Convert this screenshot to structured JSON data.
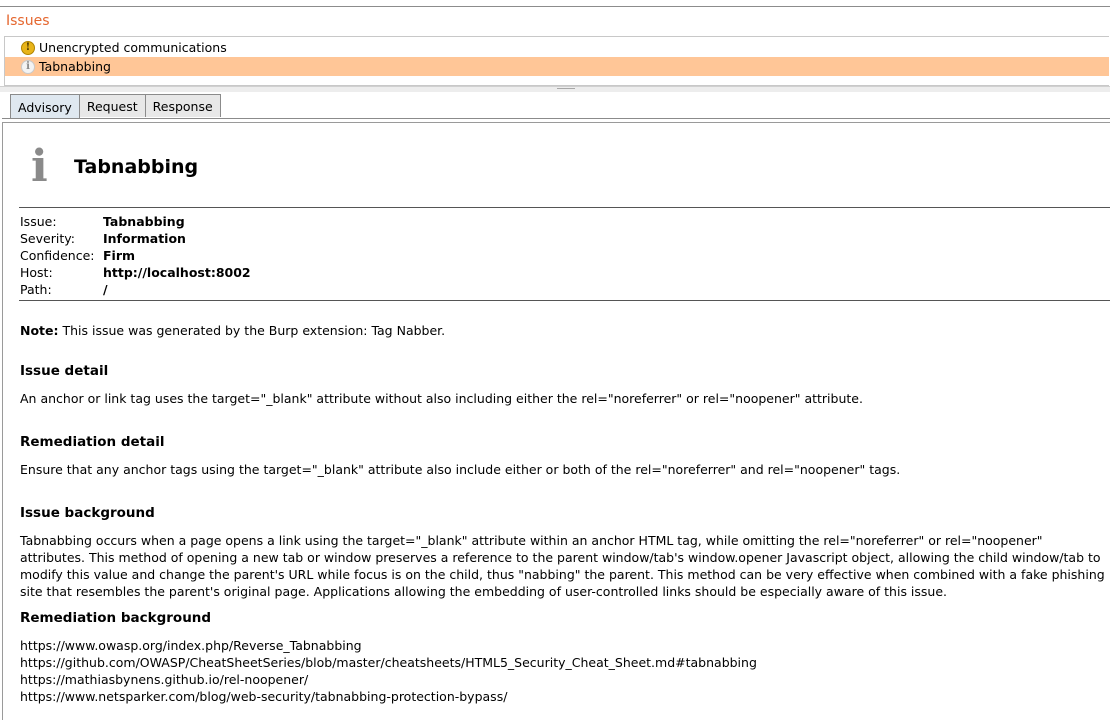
{
  "panel": {
    "title": "Issues"
  },
  "issues": [
    {
      "label": "Unencrypted communications",
      "icon": "warning-icon",
      "icon_glyph": "!"
    },
    {
      "label": "Tabnabbing",
      "icon": "info-icon",
      "icon_glyph": "i"
    }
  ],
  "tabs": {
    "advisory": "Advisory",
    "request": "Request",
    "response": "Response"
  },
  "advisory": {
    "icon_glyph": "i",
    "title": "Tabnabbing",
    "meta": {
      "issue_key": "Issue:",
      "issue_val": "Tabnabbing",
      "severity_key": "Severity:",
      "severity_val": "Information",
      "confidence_key": "Confidence:",
      "confidence_val": "Firm",
      "host_key": "Host:",
      "host_val": "http://localhost:8002",
      "path_key": "Path:",
      "path_val": "/"
    },
    "note_label": "Note:",
    "note_text": " This issue was generated by the Burp extension: Tag Nabber.",
    "issue_detail_heading": "Issue detail",
    "issue_detail": "An anchor or link tag uses the target=\"_blank\" attribute without also including either the rel=\"noreferrer\" or rel=\"noopener\" attribute.",
    "remediation_detail_heading": "Remediation detail",
    "remediation_detail": "Ensure that any anchor tags using the target=\"_blank\" attribute also include either or both of the rel=\"noreferrer\" and rel=\"noopener\" tags.",
    "issue_background_heading": "Issue background",
    "issue_background": "Tabnabbing occurs when a page opens a link using the target=\"_blank\" attribute within an anchor HTML tag, while omitting the rel=\"noreferrer\" or rel=\"noopener\" attributes. This method of opening a new tab or window preserves a reference to the parent window/tab's window.opener Javascript object, allowing the child window/tab to modify this value and change the parent's URL while focus is on the child, thus \"nabbing\" the parent. This method can be very effective when combined with a fake phishing site that resembles the parent's original page. Applications allowing the embedding of user-controlled links should be especially aware of this issue.",
    "remediation_background_heading": "Remediation background",
    "links": [
      "https://www.owasp.org/index.php/Reverse_Tabnabbing",
      "https://github.com/OWASP/CheatSheetSeries/blob/master/cheatsheets/HTML5_Security_Cheat_Sheet.md#tabnabbing",
      "https://mathiasbynens.github.io/rel-noopener/",
      "https://www.netsparker.com/blog/web-security/tabnabbing-protection-bypass/"
    ]
  },
  "colors": {
    "title_orange": "#e5672f",
    "selected_row": "#ffc697"
  }
}
